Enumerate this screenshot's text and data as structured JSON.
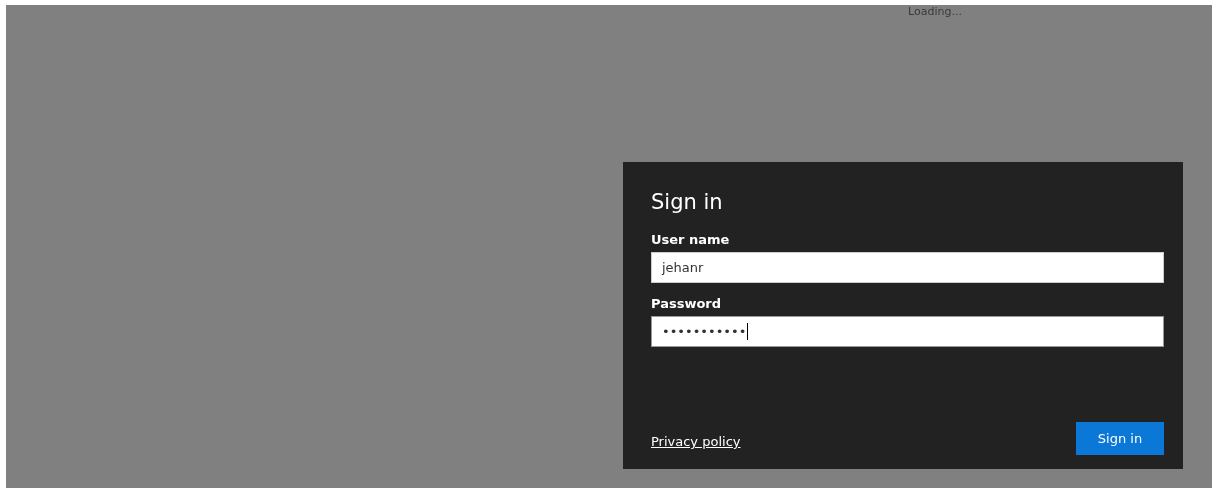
{
  "status_text": "Loading...",
  "dialog": {
    "title": "Sign in",
    "fields": [
      {
        "label": "User name",
        "value": "jehanr",
        "focused": false
      },
      {
        "label": "Password",
        "value": "•••••••••••",
        "focused": true
      }
    ],
    "privacy_link": "Privacy policy",
    "submit_button": "Sign in"
  }
}
